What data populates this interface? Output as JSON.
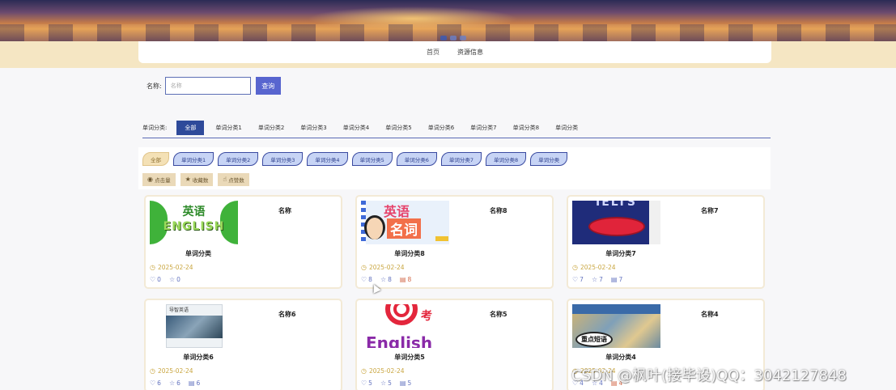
{
  "nav": {
    "items": [
      "首页",
      "资源信息"
    ]
  },
  "search": {
    "label": "名称:",
    "placeholder": "名称",
    "button": "查询"
  },
  "category_bar": {
    "label": "单词分类:",
    "items": [
      "全部",
      "单词分类1",
      "单词分类2",
      "单词分类3",
      "单词分类4",
      "单词分类5",
      "单词分类6",
      "单词分类7",
      "单词分类8",
      "单词分类"
    ]
  },
  "filter": {
    "pills": [
      "全部",
      "单词分类1",
      "单词分类2",
      "单词分类3",
      "单词分类4",
      "单词分类5",
      "单词分类6",
      "单词分类7",
      "单词分类8",
      "单词分类"
    ],
    "sorts": [
      "点击量",
      "收藏数",
      "点赞数"
    ]
  },
  "cards": [
    {
      "name": "名称",
      "category": "单词分类",
      "date": "2025-02-24",
      "likes": "0",
      "favs": "0",
      "comments": "",
      "img_text": [
        "英语",
        "ENGLISH"
      ]
    },
    {
      "name": "名称8",
      "category": "单词分类8",
      "date": "2025-02-24",
      "likes": "8",
      "favs": "8",
      "comments": "8",
      "img_text": [
        "英语",
        "名词"
      ]
    },
    {
      "name": "名称7",
      "category": "单词分类7",
      "date": "2025-02-24",
      "likes": "7",
      "favs": "7",
      "comments": "7",
      "img_text": [
        "IELTS"
      ]
    },
    {
      "name": "名称6",
      "category": "单词分类6",
      "date": "2025-02-24",
      "likes": "6",
      "favs": "6",
      "comments": "6",
      "img_text": [
        "导智英语"
      ]
    },
    {
      "name": "名称5",
      "category": "单词分类5",
      "date": "2025-02-24",
      "likes": "5",
      "favs": "5",
      "comments": "5",
      "img_text": [
        "考",
        "English"
      ]
    },
    {
      "name": "名称4",
      "category": "单词分类4",
      "date": "2025-02-24",
      "likes": "4",
      "favs": "4",
      "comments": "4",
      "img_text": [
        "重点短语"
      ]
    }
  ],
  "watermark": "CSDN @枫叶(接毕设)QQ：3042127848"
}
